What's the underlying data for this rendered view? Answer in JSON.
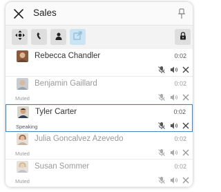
{
  "window": {
    "title": "Sales"
  },
  "toolbar": {
    "buttons": [
      "move-icon",
      "phone-icon",
      "person-icon",
      "transfer-icon",
      "lock-icon"
    ]
  },
  "participants": [
    {
      "name": "Rebecca Chandler",
      "time": "0:02",
      "status": ""
    },
    {
      "name": "Benjamin Gaillard",
      "time": "0:02",
      "status": "Muted"
    },
    {
      "name": "Tyler Carter",
      "time": "0:02",
      "status": "Speaking"
    },
    {
      "name": "Julia Goncalvez Azevedo",
      "time": "0:02",
      "status": "Muted"
    },
    {
      "name": "Susan Sommer",
      "time": "0:02",
      "status": "Muted"
    }
  ],
  "colors": {
    "accent": "#3a86c4",
    "active_button": "#cbe4f4",
    "icon": "#222222"
  }
}
